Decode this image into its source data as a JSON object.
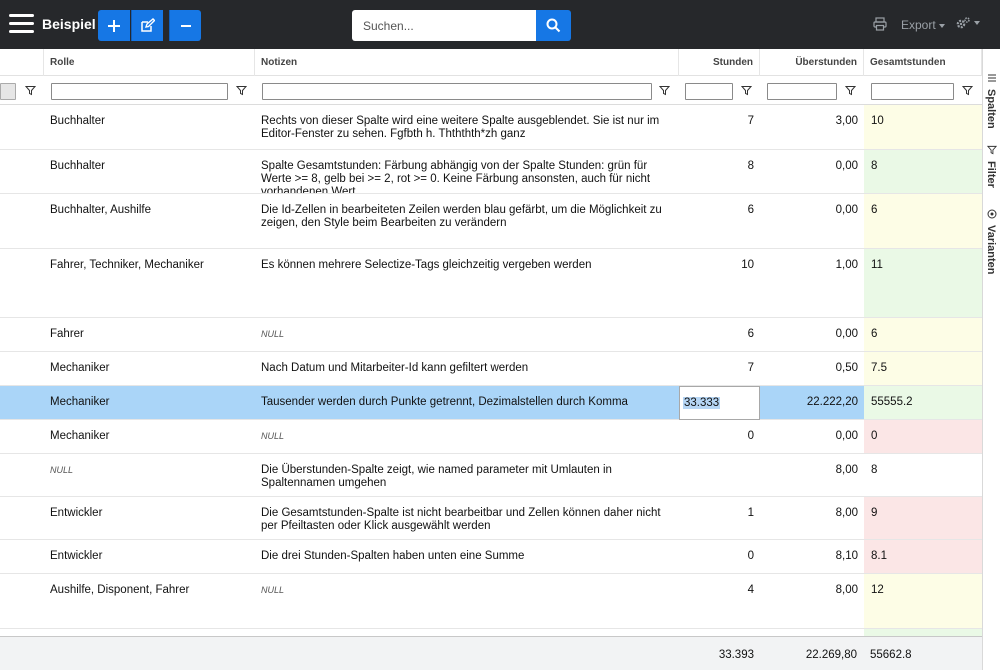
{
  "app": {
    "title": "Beispiel"
  },
  "toolbar": {
    "add_icon": "plus-icon",
    "edit_icon": "edit-icon",
    "remove_icon": "minus-icon"
  },
  "search": {
    "placeholder": "Suchen...",
    "value": ""
  },
  "header_actions": {
    "export_label": "Export"
  },
  "columns": {
    "rolle": "Rolle",
    "notizen": "Notizen",
    "stunden": "Stunden",
    "ueberstunden": "Überstunden",
    "gesamtstunden": "Gesamtstunden"
  },
  "rows": [
    {
      "rolle": "Buchhalter",
      "notizen": "Rechts von dieser Spalte wird eine weitere Spalte ausgeblendet. Sie ist nur im Editor-Fenster zu sehen. Fgfbth h. Thththth*zh ganz",
      "stunden": "7",
      "ueberstunden": "3,00",
      "gesamt": "10",
      "color": "yellow"
    },
    {
      "rolle": "Buchhalter",
      "notizen": "Spalte Gesamtstunden: Färbung abhängig von der Spalte Stunden: grün für Werte >= 8, gelb bei >= 2, rot >= 0. Keine Färbung ansonsten, auch für nicht vorhandenen Wert.",
      "stunden": "8",
      "ueberstunden": "0,00",
      "gesamt": "8",
      "color": "green"
    },
    {
      "rolle": "Buchhalter, Aushilfe",
      "notizen": "Die Id-Zellen in bearbeiteten Zeilen werden blau gefärbt, um die Möglichkeit zu zeigen, den Style beim Bearbeiten zu verändern",
      "stunden": "6",
      "ueberstunden": "0,00",
      "gesamt": "6",
      "color": "yellow"
    },
    {
      "rolle": "Fahrer, Techniker, Mechaniker",
      "notizen": "Es können mehrere Selectize-Tags gleichzeitig vergeben werden",
      "stunden": "10",
      "ueberstunden": "1,00",
      "gesamt": "11",
      "color": "green"
    },
    {
      "rolle": "Fahrer",
      "notizen": "NULL",
      "notizen_null": true,
      "stunden": "6",
      "ueberstunden": "0,00",
      "gesamt": "6",
      "color": "yellow"
    },
    {
      "rolle": "Mechaniker",
      "notizen": "Nach Datum und Mitarbeiter-Id kann gefiltert werden",
      "stunden": "7",
      "ueberstunden": "0,50",
      "gesamt": "7.5",
      "color": "yellow"
    },
    {
      "rolle": "Mechaniker",
      "notizen": "Tausender werden durch Punkte getrennt, Dezimalstellen durch Komma",
      "stunden": "33.333",
      "ueberstunden": "22.222,20",
      "gesamt": "55555.2",
      "color": "green",
      "selected": true
    },
    {
      "rolle": "Mechaniker",
      "notizen": "NULL",
      "notizen_null": true,
      "stunden": "0",
      "ueberstunden": "0,00",
      "gesamt": "0",
      "color": "red"
    },
    {
      "rolle": "NULL",
      "rolle_null": true,
      "notizen": "Die Überstunden-Spalte zeigt, wie named parameter mit Umlauten in Spaltennamen umgehen",
      "stunden": "",
      "ueberstunden": "8,00",
      "gesamt": "8",
      "color": "none"
    },
    {
      "rolle": "Entwickler",
      "notizen": "Die Gesamtstunden-Spalte ist nicht bearbeitbar und Zellen können daher nicht per Pfeiltasten oder Klick ausgewählt werden",
      "stunden": "1",
      "ueberstunden": "8,00",
      "gesamt": "9",
      "color": "red"
    },
    {
      "rolle": "Entwickler",
      "notizen": "Die drei Stunden-Spalten haben unten eine Summe",
      "stunden": "0",
      "ueberstunden": "8,10",
      "gesamt": "8.1",
      "color": "red"
    },
    {
      "rolle": "Aushilfe, Disponent, Fahrer",
      "notizen": "NULL",
      "notizen_null": true,
      "stunden": "4",
      "ueberstunden": "8,00",
      "gesamt": "12",
      "color": "yellow"
    }
  ],
  "totals": {
    "stunden": "33.393",
    "ueberstunden": "22.269,80",
    "gesamt": "55662.8"
  },
  "side_panel": {
    "spalten": "Spalten",
    "filter": "Filter",
    "varianten": "Varianten"
  }
}
